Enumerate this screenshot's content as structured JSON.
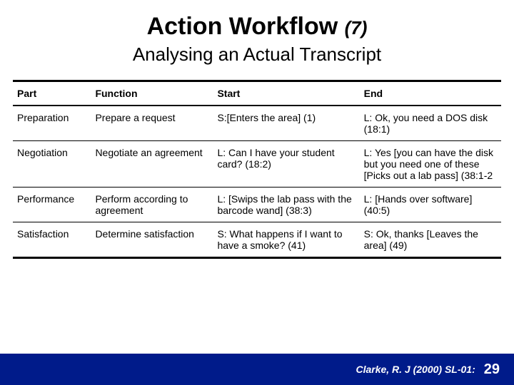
{
  "title": {
    "main": "Action Workflow",
    "num": "(7)"
  },
  "subtitle": "Analysing an Actual Transcript",
  "table": {
    "headers": [
      "Part",
      "Function",
      "Start",
      "End"
    ],
    "rows": [
      {
        "part": "Preparation",
        "func": "Prepare a request",
        "start": "S:[Enters the area] (1)",
        "end": "L: Ok, you need a DOS disk (18:1)"
      },
      {
        "part": "Negotiation",
        "func": "Negotiate an agreement",
        "start": "L: Can I have your student card? (18:2)",
        "end": "L: Yes [you can have the disk but you need one of these [Picks out a lab pass] (38:1-2"
      },
      {
        "part": "Performance",
        "func": "Perform according to agreement",
        "start": "L: [Swips the lab pass with the barcode wand] (38:3)",
        "end": "L: [Hands over software] (40:5)"
      },
      {
        "part": "Satisfaction",
        "func": "Determine satisfaction",
        "start": "S: What happens if I want to have a smoke? (41)",
        "end": "S: Ok, thanks [Leaves the area] (49)"
      }
    ]
  },
  "footer": {
    "cite": "Clarke, R. J (2000) SL-01:",
    "page": "29"
  }
}
